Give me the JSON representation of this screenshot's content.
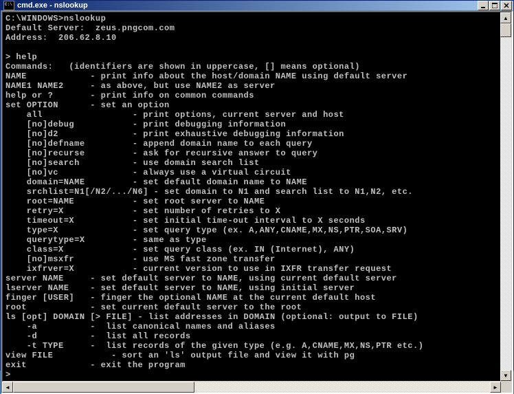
{
  "title": "cmd.exe - nslookup",
  "terminal_lines": [
    "C:\\WINDOWS>nslookup",
    "Default Server:  zeus.pngcom.com",
    "Address:  206.62.8.10",
    "",
    "> help",
    "Commands:   (identifiers are shown in uppercase, [] means optional)",
    "NAME            - print info about the host/domain NAME using default server",
    "NAME1 NAME2     - as above, but use NAME2 as server",
    "help or ?       - print info on common commands",
    "set OPTION      - set an option",
    "    all                 - print options, current server and host",
    "    [no]debug           - print debugging information",
    "    [no]d2              - print exhaustive debugging information",
    "    [no]defname         - append domain name to each query",
    "    [no]recurse         - ask for recursive answer to query",
    "    [no]search          - use domain search list",
    "    [no]vc              - always use a virtual circuit",
    "    domain=NAME         - set default domain name to NAME",
    "    srchlist=N1[/N2/.../N6] - set domain to N1 and search list to N1,N2, etc.",
    "    root=NAME           - set root server to NAME",
    "    retry=X             - set number of retries to X",
    "    timeout=X           - set initial time-out interval to X seconds",
    "    type=X              - set query type (ex. A,ANY,CNAME,MX,NS,PTR,SOA,SRV)",
    "    querytype=X         - same as type",
    "    class=X             - set query class (ex. IN (Internet), ANY)",
    "    [no]msxfr           - use MS fast zone transfer",
    "    ixfrver=X           - current version to use in IXFR transfer request",
    "server NAME     - set default server to NAME, using current default server",
    "lserver NAME    - set default server to NAME, using initial server",
    "finger [USER]   - finger the optional NAME at the current default host",
    "root            - set current default server to the root",
    "ls [opt] DOMAIN [> FILE] - list addresses in DOMAIN (optional: output to FILE)",
    "    -a          -  list canonical names and aliases",
    "    -d          -  list all records",
    "    -t TYPE     -  list records of the given type (e.g. A,CNAME,MX,NS,PTR etc.)",
    "view FILE           - sort an 'ls' output file and view it with pg",
    "exit            - exit the program",
    ">"
  ]
}
